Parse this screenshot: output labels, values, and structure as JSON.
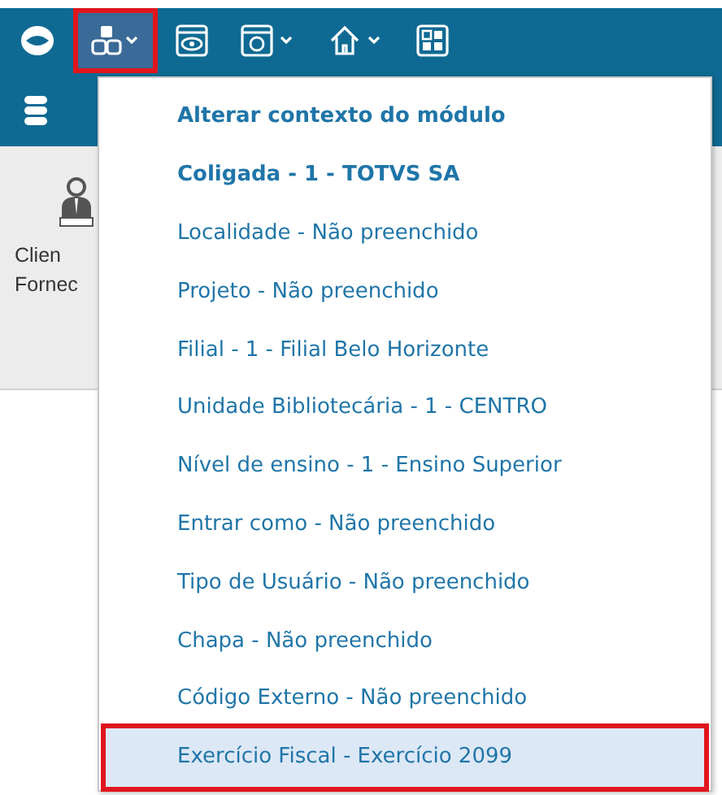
{
  "toolbar": {
    "buttons": [
      {
        "kind": "logo",
        "selected": false
      },
      {
        "kind": "context",
        "selected": true
      },
      {
        "kind": "eye",
        "selected": false
      },
      {
        "kind": "refresh",
        "selected": false
      },
      {
        "kind": "home",
        "selected": false
      },
      {
        "kind": "grid",
        "selected": false
      }
    ]
  },
  "ribbon": {
    "item": {
      "lines": [
        "Clien",
        "Fornec"
      ]
    }
  },
  "menu": {
    "items": [
      {
        "label": "Alterar contexto do módulo",
        "bold": true,
        "selected": false
      },
      {
        "label": "Coligada - 1 - TOTVS SA",
        "bold": true,
        "selected": false
      },
      {
        "label": "Localidade - Não preenchido",
        "bold": false,
        "selected": false
      },
      {
        "label": "Projeto - Não preenchido",
        "bold": false,
        "selected": false
      },
      {
        "label": "Filial - 1 - Filial Belo Horizonte",
        "bold": false,
        "selected": false
      },
      {
        "label": "Unidade Bibliotecária - 1 - CENTRO",
        "bold": false,
        "selected": false
      },
      {
        "label": "Nível de ensino - 1 - Ensino Superior",
        "bold": false,
        "selected": false
      },
      {
        "label": "Entrar como - Não preenchido",
        "bold": false,
        "selected": false
      },
      {
        "label": "Tipo de Usuário - Não preenchido",
        "bold": false,
        "selected": false
      },
      {
        "label": "Chapa - Não preenchido",
        "bold": false,
        "selected": false
      },
      {
        "label": "Código Externo - Não preenchido",
        "bold": false,
        "selected": false
      },
      {
        "label": "Exercício Fiscal - Exercício 2099",
        "bold": false,
        "selected": true
      }
    ]
  }
}
